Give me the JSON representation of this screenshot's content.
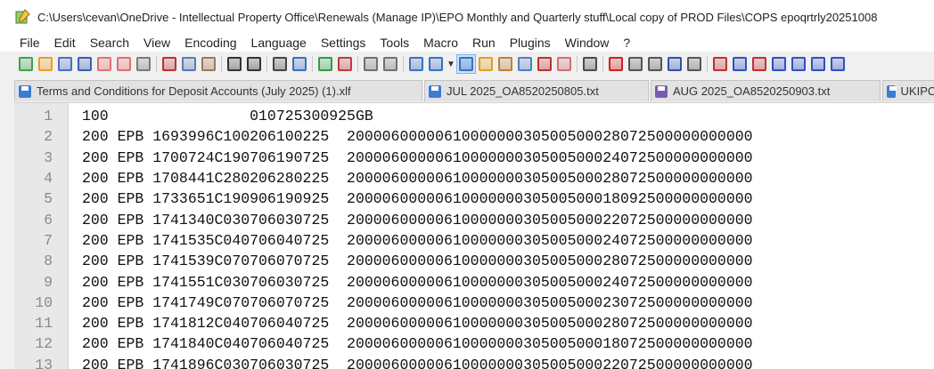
{
  "window": {
    "title": "C:\\Users\\cevan\\OneDrive - Intellectual Property Office\\Renewals (Manage IP)\\EPO Monthly and Quarterly stuff\\Local copy of PROD Files\\COPS epoqrtrly20251008"
  },
  "menu": [
    "File",
    "Edit",
    "Search",
    "View",
    "Encoding",
    "Language",
    "Settings",
    "Tools",
    "Macro",
    "Run",
    "Plugins",
    "Window",
    "?"
  ],
  "toolbar_icons": [
    {
      "name": "new-file-icon",
      "color": "#3aa545"
    },
    {
      "name": "open-file-icon",
      "color": "#e5a021"
    },
    {
      "name": "save-icon",
      "color": "#4a6fc2"
    },
    {
      "name": "save-all-icon",
      "color": "#3b5fb0"
    },
    {
      "name": "close-icon",
      "color": "#e07070"
    },
    {
      "name": "close-all-icon",
      "color": "#e07070"
    },
    {
      "name": "print-icon",
      "color": "#7a7a7a"
    },
    {
      "sep": true
    },
    {
      "name": "cut-icon",
      "color": "#c03030"
    },
    {
      "name": "copy-icon",
      "color": "#5a7ab5"
    },
    {
      "name": "paste-icon",
      "color": "#a07850"
    },
    {
      "sep": true
    },
    {
      "name": "undo-icon",
      "color": "#333333"
    },
    {
      "name": "redo-icon",
      "color": "#333333"
    },
    {
      "sep": true
    },
    {
      "name": "find-icon",
      "color": "#444444"
    },
    {
      "name": "replace-icon",
      "color": "#3a6fc0"
    },
    {
      "sep": true
    },
    {
      "name": "zoom-in-icon",
      "color": "#2e9d4a"
    },
    {
      "name": "zoom-out-icon",
      "color": "#c03a3a"
    },
    {
      "sep": true
    },
    {
      "name": "sync-vertical-icon",
      "color": "#707070"
    },
    {
      "name": "sync-horizontal-icon",
      "color": "#707070"
    },
    {
      "sep": true
    },
    {
      "name": "word-wrap-icon",
      "color": "#3a70c0"
    },
    {
      "name": "show-all-chars-icon",
      "color": "#3a70c0"
    },
    {
      "name": "dropdown-caret-icon",
      "caret": true
    },
    {
      "name": "indent-guide-icon",
      "color": "#3a70c0",
      "active": true
    },
    {
      "name": "define-language-icon",
      "color": "#e0a020"
    },
    {
      "name": "document-map-icon",
      "color": "#c08030"
    },
    {
      "name": "doc-list-icon",
      "color": "#5080c0"
    },
    {
      "name": "function-list-icon",
      "color": "#c03030"
    },
    {
      "name": "folder-workspace-icon",
      "color": "#d07070"
    },
    {
      "sep": true
    },
    {
      "name": "monitoring-icon",
      "color": "#4a4a4a"
    },
    {
      "sep": true
    },
    {
      "name": "record-macro-icon",
      "color": "#d02020"
    },
    {
      "name": "stop-record-icon",
      "color": "#555555"
    },
    {
      "name": "playback-icon",
      "color": "#555555"
    },
    {
      "name": "run-macro-multiple-icon",
      "color": "#3050b0"
    },
    {
      "name": "save-macro-icon",
      "color": "#555555"
    },
    {
      "sep": true
    },
    {
      "name": "plugin-a-icon",
      "color": "#c03030"
    },
    {
      "name": "plugin-b-icon",
      "color": "#3050c0"
    },
    {
      "name": "plugin-c-icon",
      "color": "#c03030"
    },
    {
      "name": "plugin-d-icon",
      "color": "#3050c0"
    },
    {
      "name": "arrow-up-icon",
      "color": "#3050c0"
    },
    {
      "name": "arrow-down-icon",
      "color": "#3050c0"
    },
    {
      "name": "plugin-e-icon",
      "color": "#3050c0"
    }
  ],
  "tabs": [
    {
      "label": "Terms and Conditions for Deposit Accounts (July 2025) (1).xlf",
      "color": "#3a7bd5",
      "width": 458
    },
    {
      "label": "JUL 2025_OA8520250805.txt",
      "color": "#3a7bd5",
      "width": 252
    },
    {
      "label": "AUG 2025_OA8520250903.txt",
      "color": "#7a5ab0",
      "width": 258
    },
    {
      "label": "UKIPO",
      "color": "#3a7bd5",
      "width": 70
    }
  ],
  "editor": {
    "lines": [
      {
        "num": "1",
        "text": "100                010725300925GB"
      },
      {
        "num": "2",
        "text": "200 EPB 1693996C100206100225  2000060000061000000030500500028072500000000000"
      },
      {
        "num": "3",
        "text": "200 EPB 1700724C190706190725  2000060000061000000030500500024072500000000000"
      },
      {
        "num": "4",
        "text": "200 EPB 1708441C280206280225  2000060000061000000030500500028072500000000000"
      },
      {
        "num": "5",
        "text": "200 EPB 1733651C190906190925  2000060000061000000030500500018092500000000000"
      },
      {
        "num": "6",
        "text": "200 EPB 1741340C030706030725  2000060000061000000030500500022072500000000000"
      },
      {
        "num": "7",
        "text": "200 EPB 1741535C040706040725  2000060000061000000030500500024072500000000000"
      },
      {
        "num": "8",
        "text": "200 EPB 1741539C070706070725  2000060000061000000030500500028072500000000000"
      },
      {
        "num": "9",
        "text": "200 EPB 1741551C030706030725  2000060000061000000030500500024072500000000000"
      },
      {
        "num": "10",
        "text": "200 EPB 1741749C070706070725  2000060000061000000030500500023072500000000000"
      },
      {
        "num": "11",
        "text": "200 EPB 1741812C040706040725  2000060000061000000030500500028072500000000000"
      },
      {
        "num": "12",
        "text": "200 EPB 1741840C040706040725  2000060000061000000030500500018072500000000000"
      },
      {
        "num": "13",
        "text": "200 EPB 1741896C030706030725  2000060000061000000030500500022072500000000000"
      }
    ]
  }
}
